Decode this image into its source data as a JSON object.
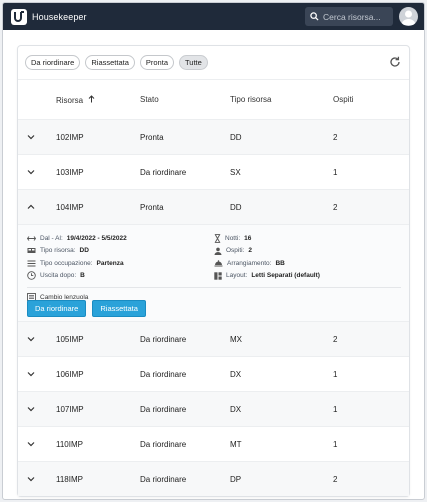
{
  "app": {
    "title": "Housekeeper"
  },
  "search": {
    "placeholder": "Cerca risorsa..."
  },
  "filters": [
    {
      "label": "Da riordinare",
      "active": false
    },
    {
      "label": "Riassettata",
      "active": false
    },
    {
      "label": "Pronta",
      "active": false
    },
    {
      "label": "Tutte",
      "active": true
    }
  ],
  "table": {
    "headers": {
      "risorsa": "Risorsa",
      "stato": "Stato",
      "tipo": "Tipo risorsa",
      "ospiti": "Ospiti"
    },
    "sort": {
      "column": "risorsa",
      "direction": "asc"
    },
    "rows": [
      {
        "risorsa": "102IMP",
        "stato": "Pronta",
        "tipo": "DD",
        "ospiti": "2",
        "expanded": false
      },
      {
        "risorsa": "103IMP",
        "stato": "Da riordinare",
        "tipo": "SX",
        "ospiti": "1",
        "expanded": false
      },
      {
        "risorsa": "104IMP",
        "stato": "Pronta",
        "tipo": "DD",
        "ospiti": "2",
        "expanded": true
      },
      {
        "risorsa": "105IMP",
        "stato": "Da riordinare",
        "tipo": "MX",
        "ospiti": "2",
        "expanded": false
      },
      {
        "risorsa": "106IMP",
        "stato": "Da riordinare",
        "tipo": "DX",
        "ospiti": "1",
        "expanded": false
      },
      {
        "risorsa": "107IMP",
        "stato": "Da riordinare",
        "tipo": "DX",
        "ospiti": "1",
        "expanded": false
      },
      {
        "risorsa": "110IMP",
        "stato": "Da riordinare",
        "tipo": "MT",
        "ospiti": "1",
        "expanded": false
      },
      {
        "risorsa": "118IMP",
        "stato": "Da riordinare",
        "tipo": "DP",
        "ospiti": "2",
        "expanded": false
      }
    ]
  },
  "details": {
    "dates": {
      "label": "Dal - Al:",
      "value": "19/4/2022 - 5/5/2022"
    },
    "tipo_risorsa": {
      "label": "Tipo risorsa:",
      "value": "DD"
    },
    "tipo_occupazione": {
      "label": "Tipo occupazione:",
      "value": "Partenza"
    },
    "uscita_dopo": {
      "label": "Uscita dopo:",
      "value": "B"
    },
    "notti": {
      "label": "Notti:",
      "value": "16"
    },
    "ospiti": {
      "label": "Ospiti:",
      "value": "2"
    },
    "arrangiamento": {
      "label": "Arrangiamento:",
      "value": "BB"
    },
    "layout": {
      "label": "Layout:",
      "value": "Letti Separati (default)"
    },
    "tag": "Cambio lenzuola",
    "buttons": {
      "da_riordinare": "Da riordinare",
      "riassettata": "Riassettata"
    }
  },
  "colors": {
    "topbar": "#1f2a3a",
    "accent": "#2aa2d9"
  }
}
